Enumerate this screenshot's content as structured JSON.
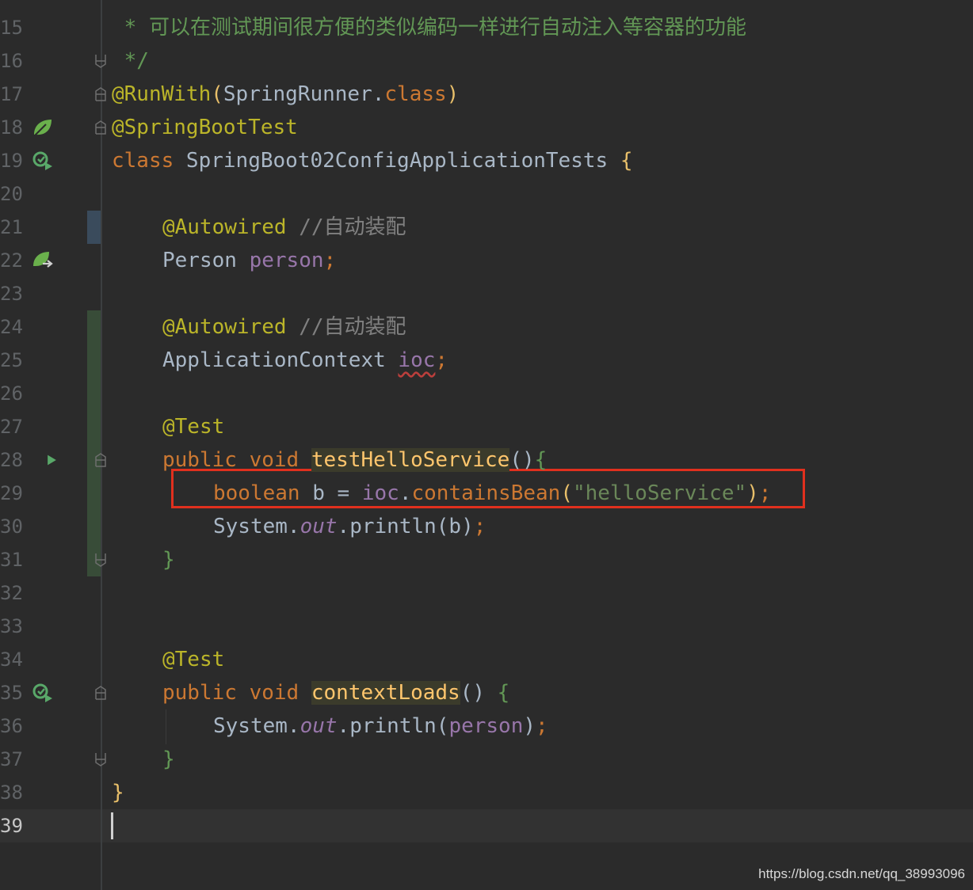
{
  "editor": {
    "lines": [
      {
        "n": "15"
      },
      {
        "n": "16"
      },
      {
        "n": "17"
      },
      {
        "n": "18"
      },
      {
        "n": "19"
      },
      {
        "n": "20"
      },
      {
        "n": "21"
      },
      {
        "n": "22"
      },
      {
        "n": "23"
      },
      {
        "n": "24"
      },
      {
        "n": "25"
      },
      {
        "n": "26"
      },
      {
        "n": "27"
      },
      {
        "n": "28"
      },
      {
        "n": "29"
      },
      {
        "n": "30"
      },
      {
        "n": "31"
      },
      {
        "n": "32"
      },
      {
        "n": "33"
      },
      {
        "n": "34"
      },
      {
        "n": "35"
      },
      {
        "n": "36"
      },
      {
        "n": "37"
      },
      {
        "n": "38"
      },
      {
        "n": "39"
      }
    ],
    "code": {
      "l15_comment": " * 可以在测试期间很方便的类似编码一样进行自动注入等容器的功能",
      "l16_comment": " */",
      "l17_ann": "@RunWith",
      "l17_p1": "(",
      "l17_cls": "SpringRunner",
      "l17_dot": ".",
      "l17_kw": "class",
      "l17_p2": ")",
      "l18_ann": "@SpringBootTest",
      "l19_kw": "class",
      "l19_name": " SpringBoot02ConfigApplicationTests ",
      "l19_brace": "{",
      "l21_ann": "@Autowired",
      "l21_cmt": " //自动装配",
      "l22_type": "Person ",
      "l22_field": "person",
      "l22_semi": ";",
      "l24_ann": "@Autowired",
      "l24_cmt": " //自动装配",
      "l25_type": "ApplicationContext ",
      "l25_field": "ioc",
      "l25_semi": ";",
      "l27_ann": "@Test",
      "l28_kw1": "public",
      "l28_kw2": "void",
      "l28_fn": "testHelloService",
      "l28_paren": "()",
      "l28_brace": "{",
      "l29_kw": "boolean",
      "l29_var": " b = ",
      "l29_field": "ioc",
      "l29_dot": ".",
      "l29_call": "containsBean",
      "l29_p1": "(",
      "l29_str": "\"helloService\"",
      "l29_p2": ")",
      "l29_semi": ";",
      "l30_sys": "System.",
      "l30_out": "out",
      "l30_rest": ".println(b)",
      "l30_semi": ";",
      "l31_brace": "}",
      "l34_ann": "@Test",
      "l35_kw1": "public",
      "l35_kw2": "void",
      "l35_fn": "contextLoads",
      "l35_paren": "() ",
      "l35_brace": "{",
      "l36_sys": "System.",
      "l36_out": "out",
      "l36_rest": ".println(",
      "l36_field": "person",
      "l36_p2": ")",
      "l36_semi": ";",
      "l37_brace": "}",
      "l38_brace": "}"
    }
  },
  "gutter_icons": {
    "l18": "spring-bean-icon",
    "l19": "run-test-class-icon",
    "l22": "autowired-bean-icon",
    "l28": "run-test-icon",
    "l35": "run-test-method-icon"
  },
  "colors": {
    "background": "#2b2b2b",
    "keyword": "#cc7832",
    "annotation": "#bbb529",
    "string": "#6a8759",
    "field": "#9876aa",
    "method": "#ffc66d",
    "highlight_box": "#e0301e"
  },
  "watermark": "https://blog.csdn.net/qq_38993096"
}
